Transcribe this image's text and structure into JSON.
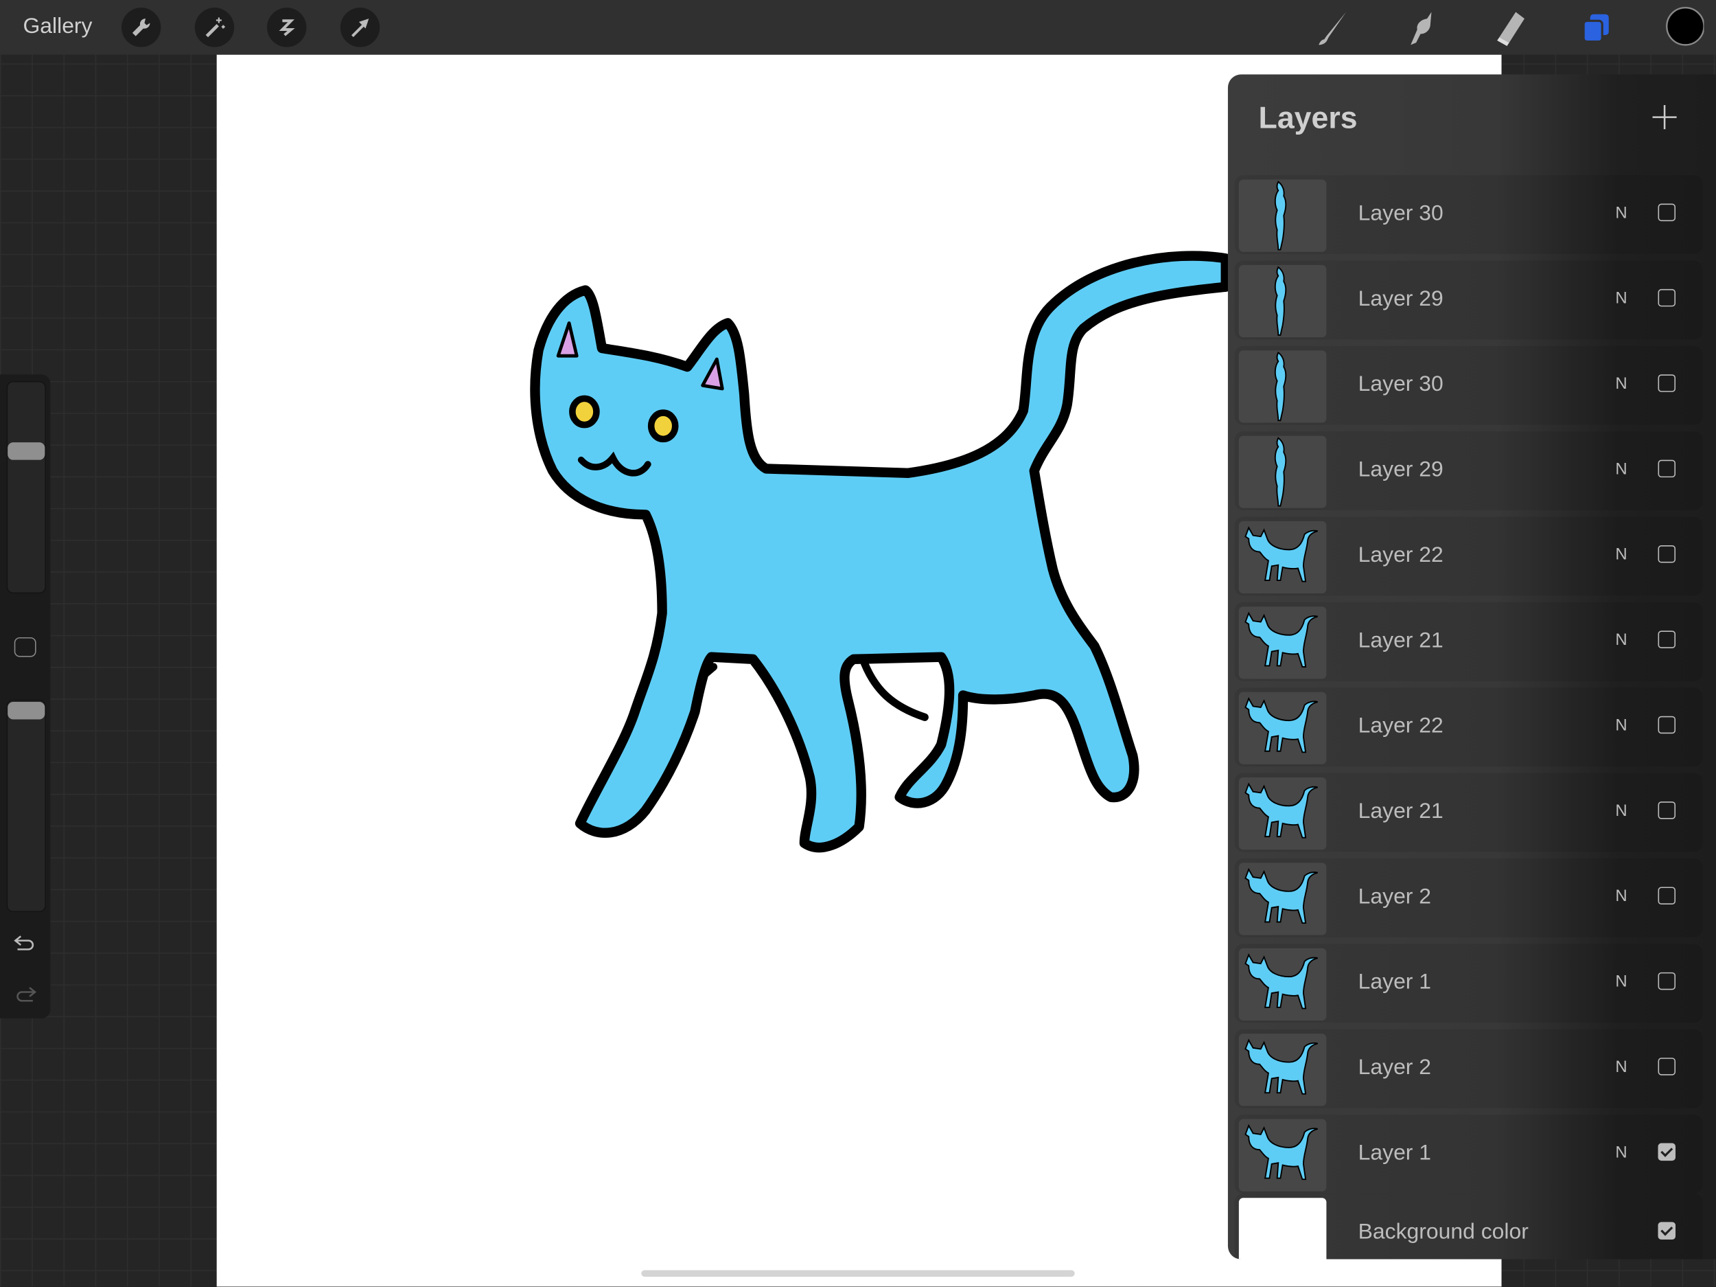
{
  "toolbar": {
    "gallery_label": "Gallery",
    "left_tools": [
      "wrench-icon",
      "magic-wand-icon",
      "selection-icon",
      "move-arrow-icon"
    ],
    "right_tools": [
      "brush-icon",
      "smudge-icon",
      "eraser-icon",
      "layers-icon",
      "color-picker"
    ],
    "active_tool": "layers",
    "accent": "#2a62e0",
    "current_color": "#000000"
  },
  "sidebar": {
    "brush_size_level": 0.25,
    "opacity_level": 0.02,
    "modify_button": "square-icon",
    "undo": "undo-icon",
    "redo": "redo-icon"
  },
  "canvas": {
    "background": "#ffffff",
    "cat_fill": "#5ecdf5",
    "outline": "#000000",
    "eye_color": "#f2d23c",
    "ear_color": "#d9a0e6"
  },
  "layers_panel": {
    "title": "Layers",
    "add_icon": "plus-icon",
    "layers": [
      {
        "name": "Layer 30",
        "mode": "N",
        "visible": false
      },
      {
        "name": "Layer 29",
        "mode": "N",
        "visible": false
      },
      {
        "name": "Layer 30",
        "mode": "N",
        "visible": false
      },
      {
        "name": "Layer 29",
        "mode": "N",
        "visible": false
      },
      {
        "name": "Layer 22",
        "mode": "N",
        "visible": false
      },
      {
        "name": "Layer 21",
        "mode": "N",
        "visible": false
      },
      {
        "name": "Layer 22",
        "mode": "N",
        "visible": false
      },
      {
        "name": "Layer 21",
        "mode": "N",
        "visible": false
      },
      {
        "name": "Layer 2",
        "mode": "N",
        "visible": false
      },
      {
        "name": "Layer 1",
        "mode": "N",
        "visible": false
      },
      {
        "name": "Layer 2",
        "mode": "N",
        "visible": false
      },
      {
        "name": "Layer 1",
        "mode": "N",
        "visible": true
      }
    ],
    "background": {
      "name": "Background color",
      "visible": true,
      "color": "#ffffff"
    }
  }
}
